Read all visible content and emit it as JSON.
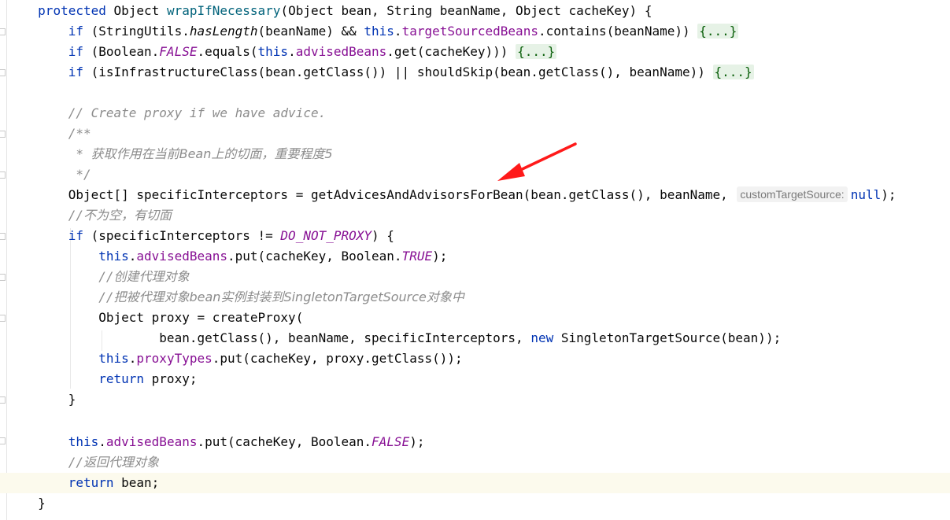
{
  "editor": {
    "lines": {
      "l1_kw": "protected",
      "l1_a": " Object ",
      "l1_m": "wrapIfNecessary",
      "l1_b": "(Object bean, String beanName, Object cacheKey) {",
      "l2_if": "if",
      "l2_a": " (StringUtils.",
      "l2_m": "hasLength",
      "l2_b": "(beanName) && ",
      "l2_this": "this",
      "l2_c": ".",
      "l2_f": "targetSourcedBeans",
      "l2_d": ".contains(beanName)) ",
      "l2_fold": "{...}",
      "l3_if": "if",
      "l3_a": " (Boolean.",
      "l3_f": "FALSE",
      "l3_b": ".equals(",
      "l3_this": "this",
      "l3_c": ".",
      "l3_f2": "advisedBeans",
      "l3_d": ".get(cacheKey))) ",
      "l3_fold": "{...}",
      "l4_if": "if",
      "l4_a": " (isInfrastructureClass(bean.getClass()) || shouldSkip(bean.getClass(), beanName)) ",
      "l4_fold": "{...}",
      "l6_cmt": "// Create proxy if we have advice.",
      "l7_cmt": "/**",
      "l8_cmt_a": " * ",
      "l8_cmt_b": "获取作用在当前Bean上的切面，重要程度5",
      "l9_cmt": " */",
      "l10_a": "Object[] specificInterceptors = getAdvicesAndAdvisorsForBean(bean.getClass(), beanName, ",
      "l10_hint": "customTargetSource:",
      "l10_null": "null",
      "l10_b": ");",
      "l11_cmt": "//",
      "l11_cmt_b": "不为空，有切面",
      "l12_if": "if",
      "l12_a": " (specificInterceptors != ",
      "l12_f": "DO_NOT_PROXY",
      "l12_b": ") {",
      "l13_this": "this",
      "l13_a": ".",
      "l13_f": "advisedBeans",
      "l13_b": ".put(cacheKey, Boolean.",
      "l13_f2": "TRUE",
      "l13_c": ");",
      "l14_cmt": "//",
      "l14_cmt_b": "创建代理对象",
      "l15_cmt": "//",
      "l15_cmt_b": "把被代理对象bean实例封装到SingletonTargetSource对象中",
      "l16_a": "Object proxy = createProxy(",
      "l17_a": "bean.getClass(), beanName, specificInterceptors, ",
      "l17_new": "new",
      "l17_b": " SingletonTargetSource(bean));",
      "l18_this": "this",
      "l18_a": ".",
      "l18_f": "proxyTypes",
      "l18_b": ".put(cacheKey, proxy.getClass());",
      "l19_ret": "return",
      "l19_a": " proxy;",
      "l20_a": "}",
      "l22_this": "this",
      "l22_a": ".",
      "l22_f": "advisedBeans",
      "l22_b": ".put(cacheKey, Boolean.",
      "l22_f2": "FALSE",
      "l22_c": ");",
      "l23_cmt": "//",
      "l23_cmt_b": "返回代理对象",
      "l24_ret": "return",
      "l24_a": " bean;",
      "l25_a": "}"
    }
  },
  "colors": {
    "keyword": "#0033b3",
    "field": "#871094",
    "method_decl": "#00627a",
    "comment": "#8c8c8c",
    "fold_bg": "#e6f2e6",
    "current_line": "#fcfaed",
    "arrow": "#ff1a1a"
  }
}
